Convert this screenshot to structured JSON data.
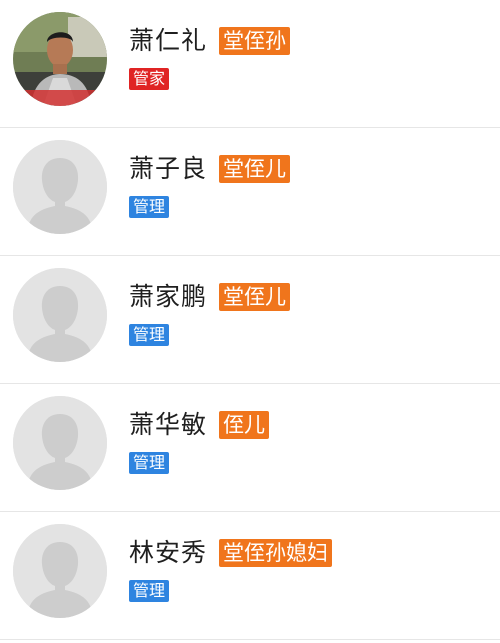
{
  "members": [
    {
      "name": "萧仁礼",
      "relation": "堂侄孙",
      "role": "管家",
      "role_type": "guanjia",
      "avatar": "photo",
      "avatar_icon": "user-photo-avatar"
    },
    {
      "name": "萧子良",
      "relation": "堂侄儿",
      "role": "管理",
      "role_type": "guanli",
      "avatar": "placeholder",
      "avatar_icon": "default-avatar-icon"
    },
    {
      "name": "萧家鹏",
      "relation": "堂侄儿",
      "role": "管理",
      "role_type": "guanli",
      "avatar": "placeholder",
      "avatar_icon": "default-avatar-icon"
    },
    {
      "name": "萧华敏",
      "relation": "侄儿",
      "role": "管理",
      "role_type": "guanli",
      "avatar": "placeholder",
      "avatar_icon": "default-avatar-icon"
    },
    {
      "name": "林安秀",
      "relation": "堂侄孙媳妇",
      "role": "管理",
      "role_type": "guanli",
      "avatar": "placeholder",
      "avatar_icon": "default-avatar-icon"
    }
  ],
  "colors": {
    "relation_badge": "#f0751c",
    "role_guanjia": "#e02424",
    "role_guanli": "#2e84e0",
    "placeholder_bg": "#e3e3e3",
    "placeholder_fg": "#cdcdcd"
  }
}
